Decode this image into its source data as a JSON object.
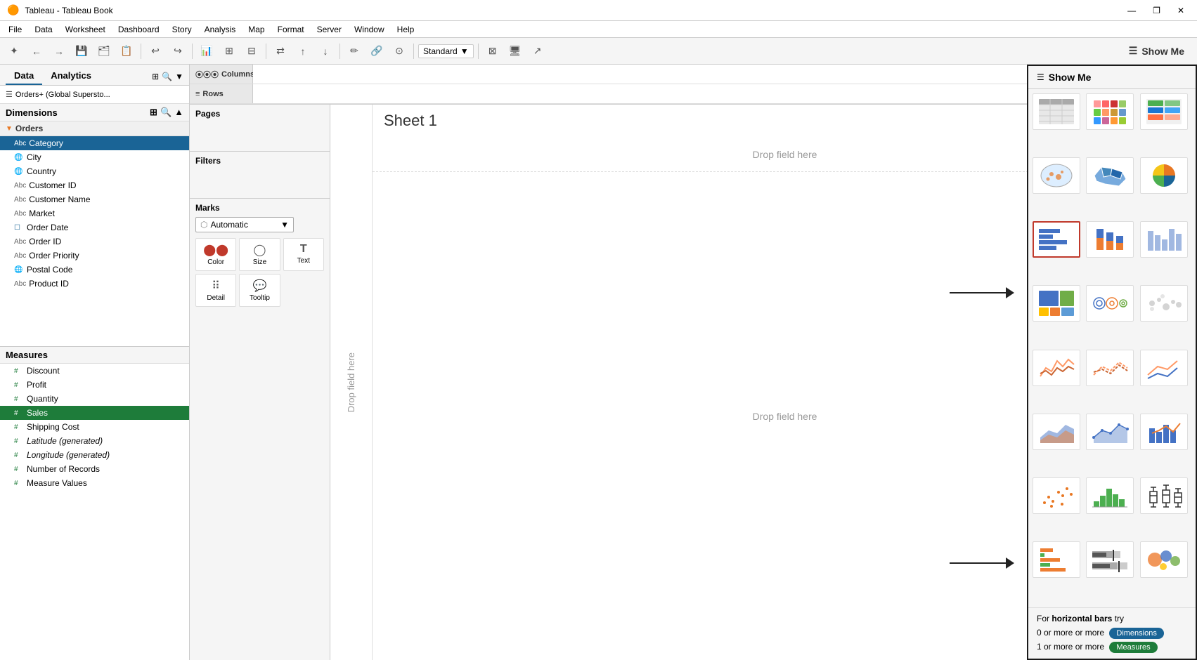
{
  "titleBar": {
    "title": "Tableau - Tableau Book",
    "icon": "🟠",
    "controls": [
      "—",
      "❐",
      "✕"
    ]
  },
  "menuBar": {
    "items": [
      "File",
      "Data",
      "Worksheet",
      "Dashboard",
      "Story",
      "Analysis",
      "Map",
      "Format",
      "Server",
      "Window",
      "Help"
    ]
  },
  "toolbar": {
    "standardLabel": "Standard",
    "showMeLabel": "Show Me"
  },
  "leftPanel": {
    "tabs": [
      "Data",
      "Analytics"
    ],
    "dataSource": "Orders+ (Global Supersto...",
    "dimensionsLabel": "Dimensions",
    "measuresLabel": "Measures",
    "groups": [
      {
        "name": "Orders",
        "fields": [
          {
            "name": "Category",
            "type": "Abc",
            "selected": true,
            "iconClass": "blue"
          },
          {
            "name": "City",
            "type": "🌐",
            "selected": false,
            "iconClass": "globe"
          },
          {
            "name": "Country",
            "type": "🌐",
            "selected": false,
            "iconClass": "globe"
          },
          {
            "name": "Customer ID",
            "type": "Abc",
            "selected": false,
            "iconClass": "blue"
          },
          {
            "name": "Customer Name",
            "type": "Abc",
            "selected": false,
            "iconClass": "blue"
          },
          {
            "name": "Market",
            "type": "Abc",
            "selected": false,
            "iconClass": "blue"
          },
          {
            "name": "Order Date",
            "type": "🗓",
            "selected": false,
            "iconClass": "blue"
          },
          {
            "name": "Order ID",
            "type": "Abc",
            "selected": false,
            "iconClass": "blue"
          },
          {
            "name": "Order Priority",
            "type": "Abc",
            "selected": false,
            "iconClass": "blue"
          },
          {
            "name": "Postal Code",
            "type": "🌐",
            "selected": false,
            "iconClass": "globe"
          },
          {
            "name": "Product ID",
            "type": "Abc",
            "selected": false,
            "iconClass": "blue"
          }
        ]
      }
    ],
    "measures": [
      {
        "name": "Discount",
        "type": "#",
        "selected": false
      },
      {
        "name": "Profit",
        "type": "#",
        "selected": false
      },
      {
        "name": "Quantity",
        "type": "#",
        "selected": false
      },
      {
        "name": "Sales",
        "type": "#",
        "selected": true
      },
      {
        "name": "Shipping Cost",
        "type": "#",
        "selected": false
      },
      {
        "name": "Latitude (generated)",
        "type": "#",
        "selected": false,
        "italic": true
      },
      {
        "name": "Longitude (generated)",
        "type": "#",
        "selected": false,
        "italic": true
      },
      {
        "name": "Number of Records",
        "type": "#",
        "selected": false
      },
      {
        "name": "Measure Values",
        "type": "#",
        "selected": false
      }
    ]
  },
  "shelves": {
    "pagesLabel": "Pages",
    "filtersLabel": "Filters",
    "marksLabel": "Marks",
    "marksType": "Automatic",
    "columnsLabel": "Columns",
    "rowsLabel": "Rows",
    "markButtons": [
      {
        "icon": "⬤⬤",
        "label": "Color"
      },
      {
        "icon": "◯",
        "label": "Size"
      },
      {
        "icon": "T",
        "label": "Text"
      },
      {
        "icon": "⠿",
        "label": "Detail"
      },
      {
        "icon": "💬",
        "label": "Tooltip"
      }
    ]
  },
  "canvas": {
    "sheetTitle": "Sheet 1",
    "dropFieldTop": "Drop field here",
    "dropFieldMain": "Drop field here",
    "dropFieldLeft": "Drop\nfield\nhere"
  },
  "showMe": {
    "header": "Show Me",
    "selectedChart": 6,
    "hintTitle": "horizontal bars",
    "hintDimensions": "0 or more",
    "hintMeasures": "1 or more",
    "dimensionsLabel": "Dimensions",
    "measuresLabel": "Measures",
    "charts": [
      {
        "id": 0,
        "type": "text-table"
      },
      {
        "id": 1,
        "type": "heat-map"
      },
      {
        "id": 2,
        "type": "highlight-table"
      },
      {
        "id": 3,
        "type": "symbol-map"
      },
      {
        "id": 4,
        "type": "filled-map"
      },
      {
        "id": 5,
        "type": "pie"
      },
      {
        "id": 6,
        "type": "horizontal-bar",
        "selected": true
      },
      {
        "id": 7,
        "type": "stacked-bar"
      },
      {
        "id": 8,
        "type": "side-bar"
      },
      {
        "id": 9,
        "type": "treemap"
      },
      {
        "id": 10,
        "type": "circle-view"
      },
      {
        "id": 11,
        "type": "side-by-side"
      },
      {
        "id": 12,
        "type": "line-continuous"
      },
      {
        "id": 13,
        "type": "line-discrete"
      },
      {
        "id": 14,
        "type": "dual-line"
      },
      {
        "id": 15,
        "type": "area-continuous"
      },
      {
        "id": 16,
        "type": "area-discrete"
      },
      {
        "id": 17,
        "type": "dual-combo"
      },
      {
        "id": 18,
        "type": "scatter"
      },
      {
        "id": 19,
        "type": "histogram"
      },
      {
        "id": 20,
        "type": "box-whisker"
      },
      {
        "id": 21,
        "type": "gantt"
      },
      {
        "id": 22,
        "type": "bullet"
      },
      {
        "id": 23,
        "type": "packed-bubbles"
      }
    ]
  }
}
